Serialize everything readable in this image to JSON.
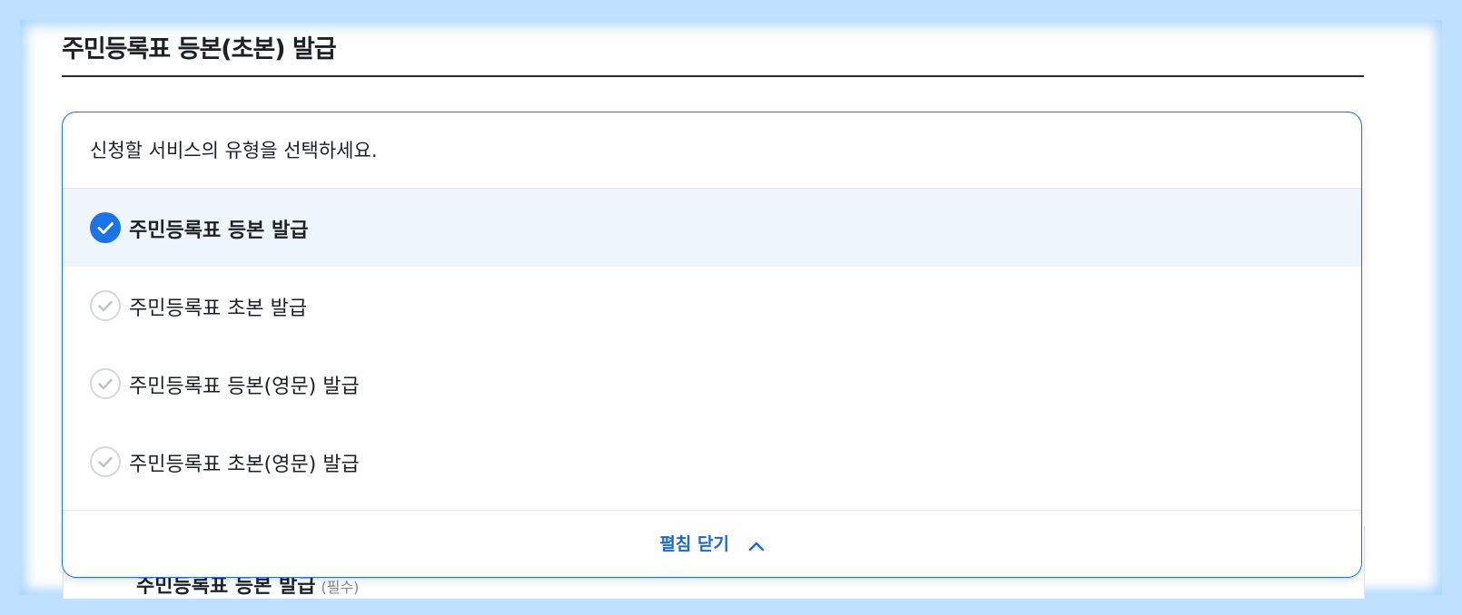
{
  "page": {
    "title": "주민등록표 등본(초본) 발급"
  },
  "selector": {
    "prompt": "신청할 서비스의 유형을 선택하세요.",
    "options": [
      {
        "label": "주민등록표 등본 발급",
        "selected": true
      },
      {
        "label": "주민등록표 초본 발급",
        "selected": false
      },
      {
        "label": "주민등록표 등본(영문) 발급",
        "selected": false
      },
      {
        "label": "주민등록표 초본(영문) 발급",
        "selected": false
      }
    ],
    "collapse_label": "펼침 닫기"
  },
  "behind": {
    "heading": "주민등록표 등본 발급",
    "sub": "(필수)"
  },
  "colors": {
    "accent": "#1a73e8",
    "selected_bg": "#eff5fd",
    "frame": "#bfe0ff"
  },
  "icons": {
    "selected": "check-circle-filled-icon",
    "unselected": "check-circle-outline-icon",
    "collapse": "chevron-up-icon"
  }
}
